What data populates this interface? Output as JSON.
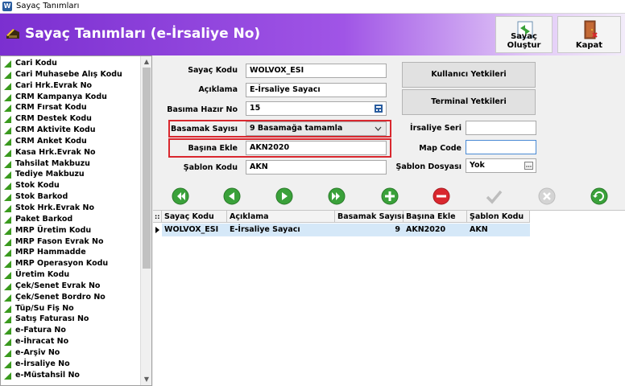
{
  "window": {
    "title": "Sayaç Tanımları"
  },
  "header": {
    "title": "Sayaç Tanımları (e-İrsaliye No)",
    "buttons": {
      "olustur_label": "Sayaç Oluştur",
      "kapat_label": "Kapat"
    }
  },
  "sidebar": {
    "items": [
      "Cari Kodu",
      "Cari Muhasebe Alış Kodu",
      "Cari Hrk.Evrak No",
      "CRM Kampanya Kodu",
      "CRM Fırsat Kodu",
      "CRM Destek Kodu",
      "CRM Aktivite Kodu",
      "CRM Anket Kodu",
      "Kasa Hrk.Evrak No",
      "Tahsilat Makbuzu",
      "Tediye Makbuzu",
      "Stok Kodu",
      "Stok Barkod",
      "Stok Hrk.Evrak No",
      "Paket Barkod",
      "MRP Üretim Kodu",
      "MRP Fason Evrak No",
      "MRP Hammadde",
      "MRP Operasyon Kodu",
      "Üretim Kodu",
      "Çek/Senet Evrak No",
      "Çek/Senet Bordro No",
      "Tüp/Su Fiş No",
      "Satış Faturası No",
      "e-Fatura No",
      "e-İhracat No",
      "e-Arşiv No",
      "e-İrsaliye No",
      "e-Müstahsil No"
    ]
  },
  "form": {
    "sayac_kodu": {
      "label": "Sayaç Kodu",
      "value": "WOLVOX_ESI"
    },
    "aciklama": {
      "label": "Açıklama",
      "value": "E-İrsaliye Sayacı"
    },
    "basima_hazir_no": {
      "label": "Basıma Hazır No",
      "value": "15"
    },
    "basamak_sayisi": {
      "label": "Basamak Sayısı",
      "value": "9 Basamağa tamamla"
    },
    "basina_ekle": {
      "label": "Başına Ekle",
      "value": "AKN2020"
    },
    "sablon_kodu": {
      "label": "Şablon Kodu",
      "value": "AKN"
    },
    "kullanici_yetkileri": "Kullanıcı Yetkileri",
    "terminal_yetkileri": "Terminal Yetkileri",
    "irsaliye_seri": {
      "label": "İrsaliye Seri",
      "value": ""
    },
    "map_code": {
      "label": "Map Code",
      "value": ""
    },
    "sablon_dosyasi": {
      "label": "Şablon Dosyası",
      "value": "Yok"
    }
  },
  "grid": {
    "columns": [
      "Sayaç Kodu",
      "Açıklama",
      "Basamak Sayısı",
      "Başına Ekle",
      "Şablon Kodu"
    ],
    "rows": [
      {
        "sayac_kodu": "WOLVOX_ESI",
        "aciklama": "E-İrsaliye Sayacı",
        "basamak_sayisi": "9",
        "basina_ekle": "AKN2020",
        "sablon_kodu": "AKN"
      }
    ]
  },
  "colors": {
    "header_start": "#7b2fd0",
    "highlight": "#d9272e",
    "nav_green": "#3aa13a",
    "selected_row": "#d5e8f8"
  },
  "icons": [
    "first-icon",
    "prev-icon",
    "next-icon",
    "last-icon",
    "add-icon",
    "delete-icon",
    "confirm-icon",
    "cancel-icon",
    "refresh-icon"
  ]
}
